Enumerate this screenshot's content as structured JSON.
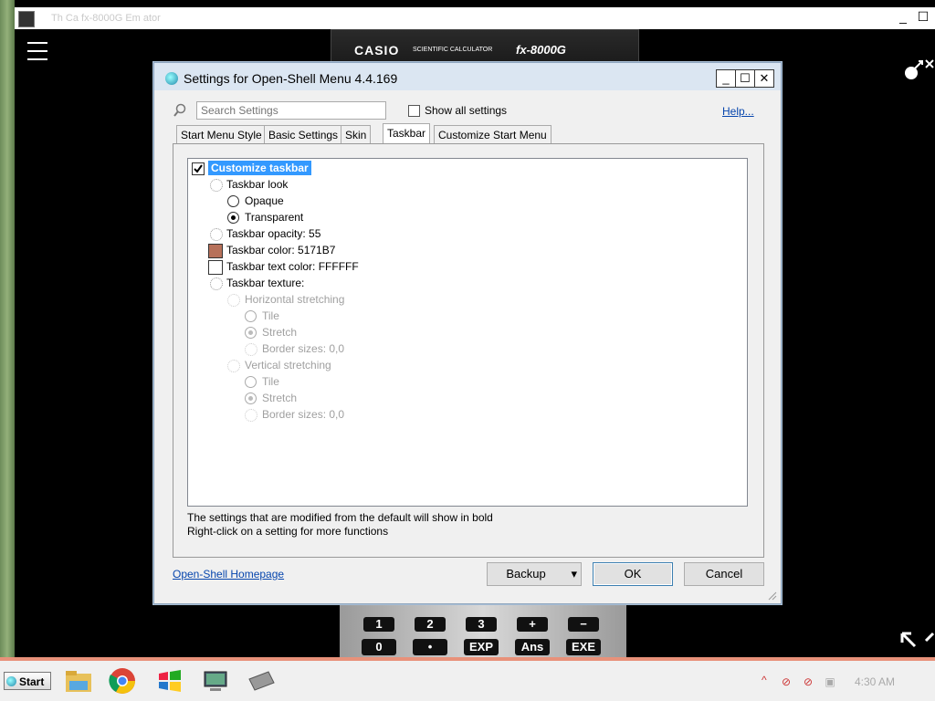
{
  "outer": {
    "title": "Th    Ca    fx-8000G Em   ator",
    "min_label": "_",
    "max_label": "☐",
    "menu_icon": "hamburger-icon",
    "resize_icon": "resize-arrows-icon",
    "collapse_icon": "collapse-arrows-icon"
  },
  "calculator": {
    "brand": "CASIO",
    "sub": "SCIENTIFIC CALCULATOR",
    "model": "fx-8000G",
    "keys_row1": [
      "1",
      "2",
      "3",
      "+",
      "−"
    ],
    "keys_row2": [
      "0",
      "•",
      "EXP",
      "Ans",
      "EXE"
    ]
  },
  "dialog": {
    "title": "Settings for Open-Shell Menu 4.4.169",
    "min": "_",
    "max": "☐",
    "close": "✕",
    "search_placeholder": "Search Settings",
    "show_all": "Show all settings",
    "help": "Help...",
    "tabs": [
      "Start Menu Style",
      "Basic Settings",
      "Skin",
      "Taskbar",
      "Customize Start Menu"
    ],
    "active_tab": "Taskbar",
    "tree": {
      "customize": "Customize taskbar",
      "look": "Taskbar look",
      "opaque": "Opaque",
      "transparent": "Transparent",
      "opacity": "Taskbar opacity: 55",
      "color": "Taskbar color: 5171B7",
      "text_color": "Taskbar text color: FFFFFF",
      "texture": "Taskbar texture:",
      "h_stretch": "Horizontal stretching",
      "h_tile": "Tile",
      "h_stretch_opt": "Stretch",
      "h_border": "Border sizes: 0,0",
      "v_stretch": "Vertical stretching",
      "v_tile": "Tile",
      "v_stretch_opt": "Stretch",
      "v_border": "Border sizes: 0,0"
    },
    "swatch_color": "#b7715a",
    "swatch_text_color": "#ffffff",
    "info_line1": "The settings that are modified from the default will show in bold",
    "info_line2": "Right-click on a setting for more functions",
    "homepage": "Open-Shell Homepage",
    "backup": "Backup",
    "ok": "OK",
    "cancel": "Cancel"
  },
  "taskbar": {
    "start": "Start",
    "time": "4:30 AM",
    "accent": "#e8917a",
    "icons": [
      "file-explorer-icon",
      "chrome-icon",
      "windows-icon",
      "computer-icon",
      "keyboard-icon"
    ]
  }
}
